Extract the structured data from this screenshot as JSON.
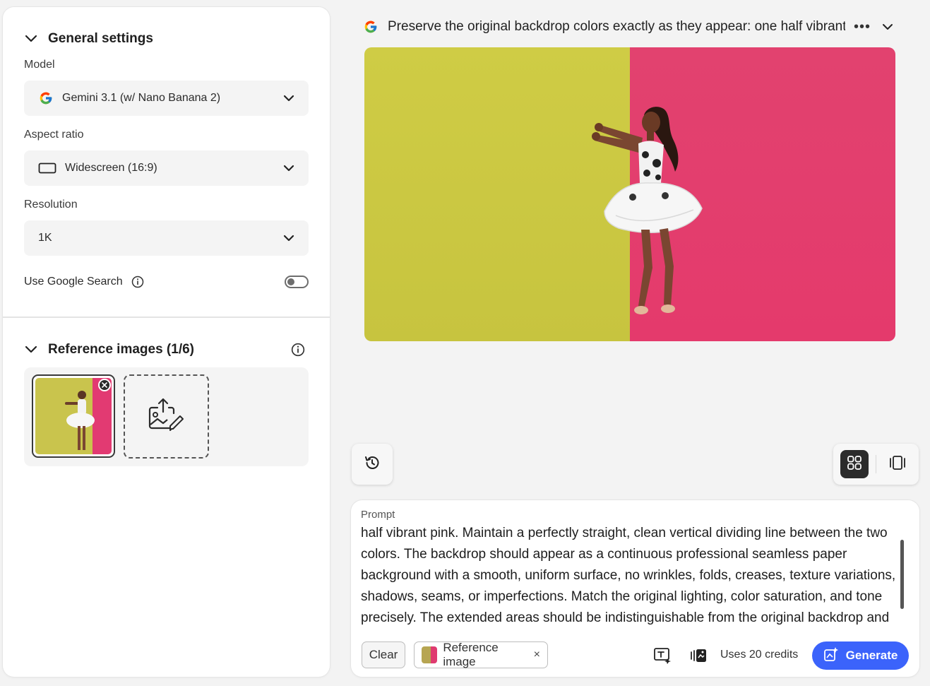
{
  "general_settings": {
    "title": "General settings",
    "model_label": "Model",
    "model_value": "Gemini 3.1 (w/ Nano Banana 2)",
    "aspect_label": "Aspect ratio",
    "aspect_value": "Widescreen (16:9)",
    "resolution_label": "Resolution",
    "resolution_value": "1K",
    "google_search_label": "Use Google Search",
    "google_search_on": false
  },
  "reference_images": {
    "title": "Reference images (1/6)",
    "count": 1,
    "max": 6
  },
  "result": {
    "prompt_title": "Preserve the original backdrop colors exactly as they appear: one half vibrant gr",
    "more_label": "•••",
    "backdrop_colors": [
      "#cfcc45",
      "#e2426f"
    ]
  },
  "prompt_panel": {
    "label": "Prompt",
    "text": "half vibrant pink. Maintain a perfectly straight, clean vertical dividing line between the two colors. The backdrop should appear as a continuous professional seamless paper background with a smooth, uniform surface, no wrinkles, folds, creases, texture variations, shadows, seams, or imperfections. Match the original lighting, color saturation, and tone precisely. The extended areas should be indistinguishable from the original backdrop and maintain a",
    "clear_label": "Clear",
    "chip_label": "Reference image",
    "chip_remove": "×",
    "credits_text": "Uses 20 credits",
    "generate_label": "Generate"
  },
  "colors": {
    "accent": "#3b63fb",
    "dark_button": "#2c2c2c"
  }
}
